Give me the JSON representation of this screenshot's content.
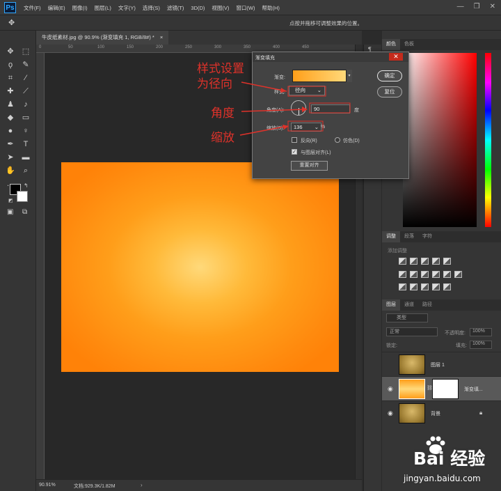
{
  "app": {
    "logo": "Ps"
  },
  "menu": [
    "文件(F)",
    "编辑(E)",
    "图像(I)",
    "图层(L)",
    "文字(Y)",
    "选择(S)",
    "滤镜(T)",
    "3D(D)",
    "视图(V)",
    "窗口(W)",
    "帮助(H)"
  ],
  "window_controls": {
    "minimize": "—",
    "restore": "❐",
    "close": "✕"
  },
  "options_bar": {
    "hint": "点按并拖移可调整效果的位置。"
  },
  "document": {
    "tab_title": "牛皮纸素材.jpg @ 90.9% (渐变填充 1, RGB/8#) *",
    "tab_close": "×",
    "ruler_ticks": [
      "0",
      "50",
      "100",
      "150",
      "200",
      "250",
      "300",
      "350",
      "400",
      "450"
    ],
    "zoom": "90.91%",
    "doc_info": "文档:929.3K/1.82M"
  },
  "dialog": {
    "title": "渐变填充",
    "close": "✕",
    "gradient_label": "渐变:",
    "style_label": "样式:",
    "style_value": "径向",
    "angle_label": "角度(A):",
    "angle_value": "90",
    "angle_unit": "度",
    "scale_label": "缩放(S):",
    "scale_value": "136",
    "scale_unit": "%",
    "reverse_label": "反向(R)",
    "dither_label": "仿色(D)",
    "align_label": "与图层对齐(L)",
    "align_checked": true,
    "reset_align": "重置对齐",
    "ok": "确定",
    "reset": "复位"
  },
  "annotations": {
    "style": "样式设置\n为径向",
    "angle": "角度",
    "scale": "缩放",
    "color": "#e0322a"
  },
  "panels": {
    "color_tabs": [
      "颜色",
      "色板"
    ],
    "adjust_tabs": [
      "调整",
      "段落",
      "字符"
    ],
    "adjust_title": "添加调整",
    "layer_tabs": [
      "图层",
      "通道",
      "路径"
    ],
    "filter": "类型",
    "blend_mode": "正常",
    "opacity_label": "不透明度:",
    "opacity_value": "100%",
    "lock_label": "锁定:",
    "fill_label": "填充:",
    "fill_value": "100%",
    "layers": [
      {
        "name": "图层 1",
        "visible": false
      },
      {
        "name": "渐变填...",
        "visible": true,
        "active": true
      },
      {
        "name": "背景",
        "visible": true,
        "locked": true
      }
    ]
  },
  "watermark": {
    "brand": "Bai 经验",
    "url": "jingyan.baidu.com"
  }
}
